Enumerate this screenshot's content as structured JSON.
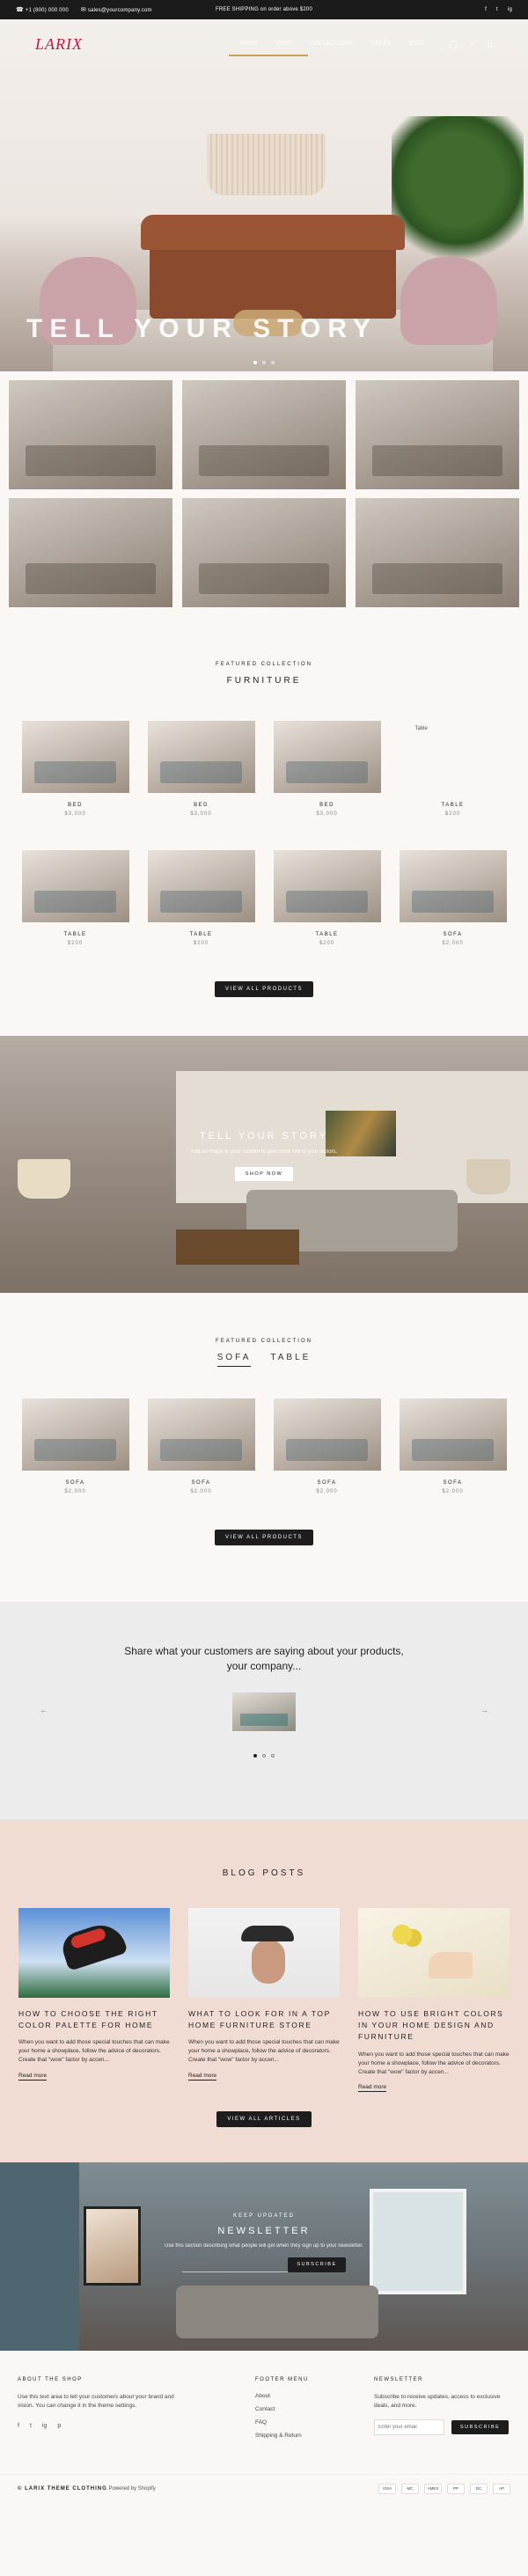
{
  "topbar": {
    "phone": "+1 (800) 000 000",
    "email": "sales@yourcompany.com",
    "announcement": "FREE SHIPPING on order above $200",
    "social": [
      "f",
      "t",
      "ig"
    ]
  },
  "header": {
    "logo": "LARIX",
    "nav": [
      "HOME",
      "SHOP",
      "COLLECTIONS",
      "PAGES",
      "BLOG"
    ],
    "icons": [
      "user-icon",
      "search-icon",
      "cart-icon"
    ]
  },
  "hero": {
    "title": "TELL YOUR STORY",
    "slides": 3,
    "active_slide": 1
  },
  "gallery": {
    "images": [
      "living-room",
      "living-room",
      "dining-room",
      "dining-room",
      "dining-room",
      "living-room"
    ]
  },
  "featured1": {
    "eyebrow": "FEATURED COLLECTION",
    "title": "FURNITURE",
    "products": [
      {
        "name": "BED",
        "price": "$3,000"
      },
      {
        "name": "BED",
        "price": "$3,000"
      },
      {
        "name": "BED",
        "price": "$3,000"
      },
      {
        "name": "TABLE",
        "price": "$200",
        "alt": "Table"
      },
      {
        "name": "TABLE",
        "price": "$200"
      },
      {
        "name": "TABLE",
        "price": "$200"
      },
      {
        "name": "TABLE",
        "price": "$200"
      },
      {
        "name": "SOFA",
        "price": "$2,000"
      }
    ],
    "button": "VIEW ALL PRODUCTS"
  },
  "story": {
    "title": "TELL YOUR STORY",
    "text": "Add an image to your content to give more info to your visitors.",
    "button": "SHOP NOW"
  },
  "featured2": {
    "eyebrow": "FEATURED COLLECTION",
    "tabs": [
      "SOFA",
      "TABLE"
    ],
    "active_tab": 0,
    "products": [
      {
        "name": "SOFA",
        "price": "$2,000"
      },
      {
        "name": "SOFA",
        "price": "$2,000"
      },
      {
        "name": "SOFA",
        "price": "$2,000"
      },
      {
        "name": "SOFA",
        "price": "$2,000"
      }
    ],
    "button": "VIEW ALL PRODUCTS"
  },
  "testimonials": {
    "quote": "Share what your customers are saying about your products, your company...",
    "dots": 3,
    "active": 0
  },
  "blog": {
    "title": "BLOG POSTS",
    "posts": [
      {
        "title": "HOW TO CHOOSE THE RIGHT COLOR PALETTE FOR HOME",
        "excerpt": "When you want to add those special touches that can make your home a showplace, follow the advice of decorators. Create that \"wow\" factor by accen...",
        "link": "Read more"
      },
      {
        "title": "WHAT TO LOOK FOR IN A TOP HOME FURNITURE STORE",
        "excerpt": "When you want to add those special touches that can make your home a showplace, follow the advice of decorators. Create that \"wow\" factor by accen...",
        "link": "Read more"
      },
      {
        "title": "HOW TO USE BRIGHT COLORS IN YOUR HOME DESIGN AND FURNITURE",
        "excerpt": "When you want to add those special touches that can make your home a showplace, follow the advice of decorators. Create that \"wow\" factor by accen...",
        "link": "Read more"
      }
    ],
    "button": "VIEW ALL ARTICLES"
  },
  "newsletter": {
    "eyebrow": "KEEP UPDATED",
    "title": "NEWSLETTER",
    "text": "Use this section describing what people will get when they sign up to your newsletter.",
    "placeholder": "Your email",
    "button": "SUBSCRIBE"
  },
  "footer": {
    "about_title": "ABOUT THE SHOP",
    "about_text": "Use this text area to tell your customers about your brand and vision. You can change it in the theme settings.",
    "social": [
      "f",
      "t",
      "ig",
      "p"
    ],
    "menu_title": "FOOTER MENU",
    "menu": [
      "About",
      "Contact",
      "FAQ",
      "Shipping & Return"
    ],
    "news_title": "NEWSLETTER",
    "news_text": "Subscribe to receive updates, access to exclusive deals, and more.",
    "placeholder": "Enter your email",
    "button": "SUBSCRIBE",
    "copyright_brand": "© LARIX THEME CLOTHING",
    "copyright_suffix": "Powered by Shopify",
    "payments": [
      "VISA",
      "MC",
      "AMEX",
      "PP",
      "DC",
      "AP"
    ]
  }
}
